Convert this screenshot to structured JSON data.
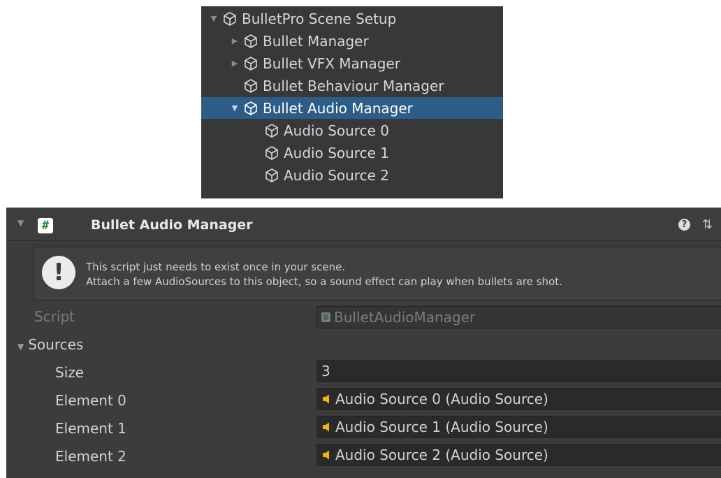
{
  "hierarchy": {
    "items": [
      {
        "label": "BulletPro Scene Setup",
        "arrow": "▼",
        "selected": false
      },
      {
        "label": "Bullet Manager",
        "arrow": "▶",
        "selected": false
      },
      {
        "label": "Bullet VFX Manager",
        "arrow": "▶",
        "selected": false
      },
      {
        "label": "Bullet Behaviour Manager",
        "arrow": "",
        "selected": false
      },
      {
        "label": "Bullet Audio Manager",
        "arrow": "▼",
        "selected": true
      },
      {
        "label": "Audio Source 0",
        "arrow": "",
        "selected": false
      },
      {
        "label": "Audio Source 1",
        "arrow": "",
        "selected": false
      },
      {
        "label": "Audio Source 2",
        "arrow": "",
        "selected": false
      }
    ]
  },
  "inspector": {
    "fold_arrow": "▼",
    "script_icon_glyph": "#",
    "title": "Bullet Audio Manager",
    "help_icon_glyph": "?",
    "presets_icon_glyph": "⇅",
    "helpbox": {
      "icon_glyph": "!",
      "line1": "This script just needs to exist once in your scene.",
      "line2": "Attach a few AudioSources to this object, so a sound effect can play when bullets are shot."
    },
    "script_label": "Script",
    "script_value": "BulletAudioManager",
    "sources_arrow": "▼",
    "sources_label": "Sources",
    "size_label": "Size",
    "size_value": "3",
    "elements": [
      {
        "label": "Element 0",
        "value": "Audio Source 0 (Audio Source)"
      },
      {
        "label": "Element 1",
        "value": "Audio Source 1 (Audio Source)"
      },
      {
        "label": "Element 2",
        "value": "Audio Source 2 (Audio Source)"
      }
    ]
  },
  "colors": {
    "hierarchy_bg": "#383838",
    "selection": "#2c5d87",
    "inspector_bg": "#3c3c3c",
    "field_bg": "#2a2a2a",
    "speaker_icon": "#f2b600",
    "script_icon_green": "#1c8a3c"
  }
}
